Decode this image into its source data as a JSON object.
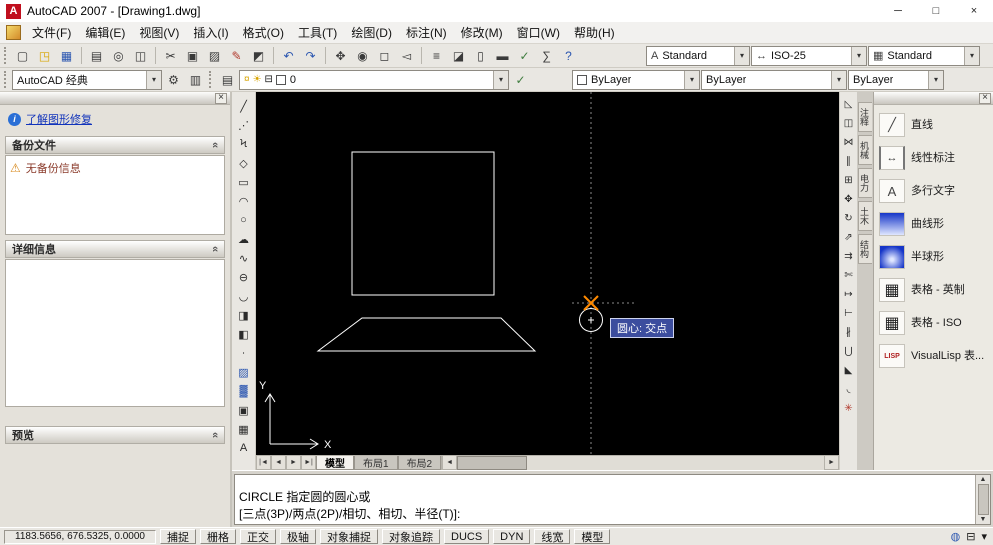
{
  "colors": {
    "tooltip_bg": "#3c4d9e",
    "drawing_bg": "#000000",
    "snap_marker_orange": "#ff8a00",
    "link_blue": "#1133bb",
    "app_logo_red": "#c00f1e"
  },
  "titlebar": {
    "title": "AutoCAD 2007 - [Drawing1.dwg]"
  },
  "menu": {
    "items": [
      "文件(F)",
      "编辑(E)",
      "视图(V)",
      "插入(I)",
      "格式(O)",
      "工具(T)",
      "绘图(D)",
      "标注(N)",
      "修改(M)",
      "窗口(W)",
      "帮助(H)"
    ]
  },
  "styles_toolbar": {
    "text_style": "Standard",
    "dim_style": "ISO-25",
    "table_style": "Standard"
  },
  "workspace_toolbar": {
    "workspace": "AutoCAD 经典"
  },
  "layers_toolbar": {
    "current_layer": "0"
  },
  "properties_toolbar": {
    "color": "ByLayer",
    "linetype": "ByLayer",
    "lineweight": "ByLayer"
  },
  "recovery_panel": {
    "help_link": "了解图形修复",
    "backup_header": "备份文件",
    "backup_message": "无备份信息",
    "details_header": "详细信息",
    "preview_header": "预览"
  },
  "drawing": {
    "snap_tooltip": "圆心: 交点",
    "ucs_x_label": "X",
    "ucs_y_label": "Y"
  },
  "layout_tabs": {
    "model": "模型",
    "layout1": "布局1",
    "layout2": "布局2"
  },
  "command_line": {
    "line1": "CIRCLE 指定圆的圆心或",
    "line2": "[三点(3P)/两点(2P)/相切、相切、半径(T)]:"
  },
  "statusbar": {
    "coordinates": "1183.5656, 676.5325, 0.0000",
    "toggles": [
      "捕捉",
      "栅格",
      "正交",
      "极轴",
      "对象捕捉",
      "对象追踪",
      "DUCS",
      "DYN",
      "线宽",
      "模型"
    ]
  },
  "tool_palette": {
    "tabs": [
      "注释",
      "机械",
      "电力",
      "土木",
      "结构"
    ],
    "items": [
      {
        "label": "直线"
      },
      {
        "label": "线性标注"
      },
      {
        "label": "多行文字"
      },
      {
        "label": "曲线形"
      },
      {
        "label": "半球形"
      },
      {
        "label": "表格 - 英制"
      },
      {
        "label": "表格 - ISO"
      },
      {
        "label": "VisualLisp 表..."
      }
    ]
  },
  "icons": {
    "min": "─",
    "max": "□",
    "close": "×",
    "chevron": "«",
    "combo_arrow": "▾",
    "info": "i",
    "new": "▢",
    "open": "◳",
    "save": "▦",
    "plot": "▤",
    "preview": "◎",
    "publish": "◫",
    "cut": "✂",
    "copy": "▣",
    "paste": "▨",
    "match": "✎",
    "block_editor": "◩",
    "undo": "↶",
    "redo": "↷",
    "pan": "✥",
    "zoom_realtime": "◉",
    "zoom_window": "◻",
    "zoom_prev": "◅",
    "properties": "≡",
    "designcenter": "◪",
    "palettes": "▯",
    "sheetset": "▬",
    "markup": "✓",
    "calc": "∑",
    "help": "?",
    "text_style": "A",
    "dim_style": "↔",
    "table_style": "▦",
    "ws_settings": "⚙",
    "ws_save": "▥",
    "layers": "▤",
    "bulb": "¤",
    "sun": "☀",
    "lock": "⊟",
    "make_current": "✓",
    "line": "╱",
    "xline": "⋰",
    "polyline": "Ϟ",
    "polygon": "◇",
    "rectangle": "▭",
    "arc": "◠",
    "circle": "○",
    "revcloud": "☁",
    "spline": "∿",
    "ellipse": "⊖",
    "ellipse_arc": "◡",
    "insert_block": "◨",
    "make_block": "◧",
    "point": "∙",
    "hatch": "▨",
    "gradient": "▓",
    "region": "▣",
    "table": "▦",
    "mtext": "A",
    "erase": "◺",
    "copy2": "◫",
    "mirror": "⋈",
    "offset": "∥",
    "array": "⊞",
    "move": "✥",
    "rotate": "↻",
    "scale": "⇗",
    "stretch": "⇉",
    "trim": "✄",
    "extend": "↦",
    "break_pt": "⊢",
    "break": "∦",
    "join": "⋃",
    "chamfer": "◣",
    "fillet": "◟",
    "explode": "✳",
    "tab_first": "|◄",
    "tab_prev": "◄",
    "tab_next": "►",
    "tab_last": "►|",
    "arr_left": "◄",
    "arr_right": "►",
    "arr_up": "▲",
    "arr_down": "▼",
    "no_backup": "⚠",
    "pal_line": "╱",
    "pal_dim": "↔",
    "pal_text": "A",
    "pal_table": "▦",
    "pal_lisp": "LISP",
    "comm": "◍",
    "tray_lock": "⊟",
    "tray_arrow": "▾"
  }
}
